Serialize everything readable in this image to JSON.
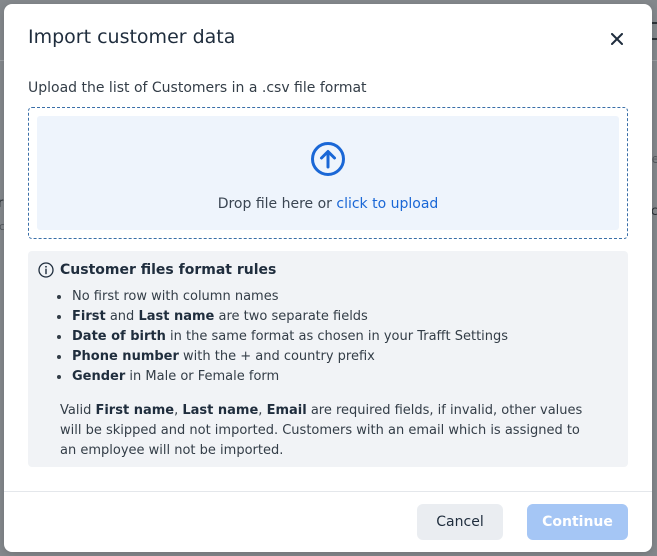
{
  "modal": {
    "title": "Import customer data",
    "close_icon": "close-icon",
    "subtitle": "Upload the list of Customers in a .csv file format"
  },
  "dropzone": {
    "icon": "upload-arrow-icon",
    "text": "Drop file here or",
    "link": "click to upload"
  },
  "rules": {
    "icon": "info-icon",
    "title": "Customer files format rules",
    "items": [
      {
        "bold": "",
        "text": "No first row with column names"
      },
      {
        "bold1": "First",
        "mid": " and ",
        "bold2": "Last name",
        "text": " are two separate fields"
      },
      {
        "bold": "Date of birth",
        "text": " in the same format as chosen in your Trafft Settings"
      },
      {
        "bold": "Phone number",
        "text": " with the + and country prefix"
      },
      {
        "bold": "Gender",
        "text": " in Male or Female form"
      }
    ],
    "note": {
      "pre": "Valid ",
      "b1": "First name",
      "sep1": ", ",
      "b2": "Last name",
      "sep2": ", ",
      "b3": "Email",
      "post": " are required fields, if invalid, other values will be skipped and not imported. Customers with an email which is assigned to an employee will not be imported."
    }
  },
  "footer": {
    "cancel_label": "Cancel",
    "continue_label": "Continue"
  },
  "colors": {
    "accent": "#1a67d6",
    "continue_disabled": "#a5c6f5",
    "dropzone_bg": "#eef4fc",
    "rules_bg": "#f1f3f6"
  }
}
